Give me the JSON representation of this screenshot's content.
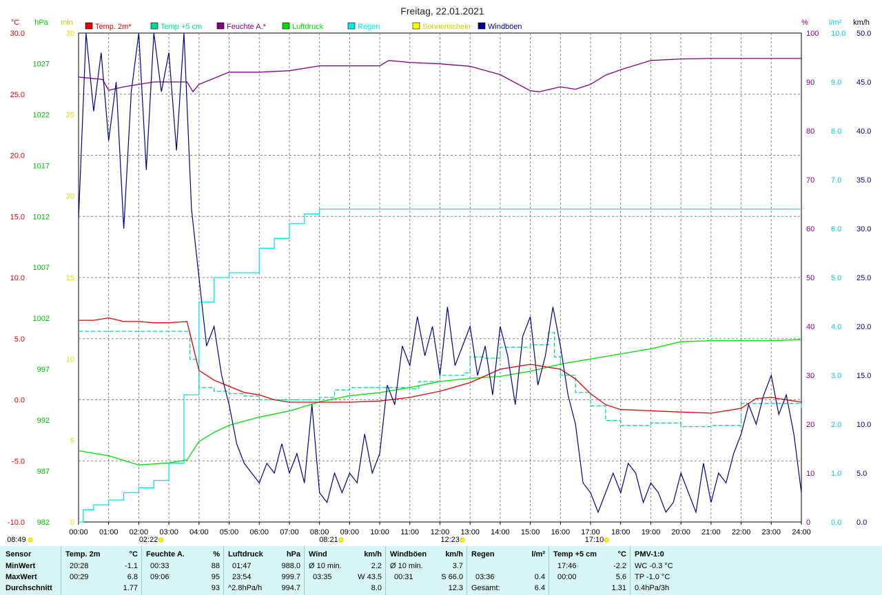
{
  "title": "Freitag, 22.01.2021",
  "colors": {
    "temp2m": "#e00000",
    "temp5cm": "#00d890",
    "humidity": "#800080",
    "pressure": "#00dd00",
    "rain": "#00e8e8",
    "sunshine": "#ffff00",
    "gusts": "#00008b",
    "grid": "#808080"
  },
  "axis_units": {
    "temp": "°C",
    "pressure": "hPa",
    "sunshine": "min",
    "humidity": "%",
    "rain": "l/m²",
    "wind": "km/h"
  },
  "chart_data": {
    "type": "line",
    "legend": [
      {
        "name": "Temp. 2m*",
        "color": "#e00000"
      },
      {
        "name": "Temp +5 cm",
        "color": "#00d890"
      },
      {
        "name": "Feuchte A.*",
        "color": "#800080"
      },
      {
        "name": "Luftdruck",
        "color": "#00dd00"
      },
      {
        "name": "Regen",
        "color": "#00e8e8"
      },
      {
        "name": "Sonnenschein",
        "color": "#ffff00"
      },
      {
        "name": "Windböen",
        "color": "#00008b"
      }
    ],
    "x_ticks": [
      "00:00",
      "01:00",
      "02:00",
      "03:00",
      "04:00",
      "05:00",
      "06:00",
      "07:00",
      "08:00",
      "09:00",
      "10:00",
      "11:00",
      "12:00",
      "13:00",
      "14:00",
      "15:00",
      "16:00",
      "17:00",
      "18:00",
      "19:00",
      "20:00",
      "21:00",
      "22:00",
      "23:00",
      "24:00"
    ],
    "xlim": [
      0,
      24
    ],
    "temp_axis": {
      "ylim": [
        -10,
        30
      ],
      "ticks": [
        "-10.0",
        "-5.0",
        "0.0",
        "5.0",
        "10.0",
        "15.0",
        "20.0",
        "25.0",
        "30.0"
      ]
    },
    "pressure_axis": {
      "ylim": [
        982,
        1030
      ],
      "ticks": [
        "982",
        "987",
        "992",
        "997",
        "1002",
        "1007",
        "1012",
        "1017",
        "1022",
        "1027"
      ]
    },
    "sunshine_axis": {
      "ylim": [
        0,
        30
      ],
      "ticks": [
        "0",
        "5",
        "10",
        "15",
        "20",
        "25",
        "30"
      ]
    },
    "humidity_axis": {
      "ylim": [
        0,
        100
      ],
      "ticks": [
        "0",
        "10",
        "20",
        "30",
        "40",
        "50",
        "60",
        "70",
        "80",
        "90",
        "100"
      ]
    },
    "rain_axis": {
      "ylim": [
        0,
        10
      ],
      "ticks": [
        "0.0",
        "1.0",
        "2.0",
        "3.0",
        "4.0",
        "5.0",
        "6.0",
        "7.0",
        "8.0",
        "9.0",
        "10.0"
      ]
    },
    "wind_axis": {
      "ylim": [
        0,
        50
      ],
      "ticks": [
        "0.0",
        "5.0",
        "10.0",
        "15.0",
        "20.0",
        "25.0",
        "30.0",
        "35.0",
        "40.0",
        "45.0",
        "50.0"
      ]
    },
    "sun_markers": [
      {
        "label": "08:49",
        "hour": 0.0
      },
      {
        "label": "02:22",
        "hour": 2.37
      },
      {
        "label": "08:21",
        "hour": 8.35
      },
      {
        "label": "12:23",
        "hour": 12.38
      },
      {
        "label": "17:10",
        "hour": 17.17
      }
    ],
    "series": [
      {
        "name": "Temp. 2m*",
        "axis": "temp",
        "x": [
          0,
          0.5,
          1,
          1.5,
          2,
          2.5,
          3,
          3.6,
          4,
          4.5,
          5,
          5.5,
          6,
          6.5,
          7,
          8,
          9,
          10,
          11,
          12,
          13,
          14,
          15,
          16,
          16.5,
          17,
          17.5,
          18,
          19,
          20,
          21,
          21.5,
          22,
          22.5,
          23,
          23.5,
          24
        ],
        "y": [
          6.5,
          6.5,
          6.7,
          6.4,
          6.4,
          6.3,
          6.3,
          6.4,
          2.4,
          1.6,
          1.1,
          0.6,
          0.4,
          0.0,
          -0.2,
          -0.2,
          -0.2,
          -0.1,
          0.2,
          0.7,
          1.4,
          2.5,
          2.9,
          2.5,
          1.7,
          0.5,
          -0.4,
          -0.8,
          -0.9,
          -1.0,
          -1.1,
          -0.9,
          -0.7,
          0.1,
          0.2,
          0.0,
          -0.2
        ]
      },
      {
        "name": "Temp +5 cm",
        "axis": "temp",
        "x": [
          0,
          1,
          1.8,
          2.2,
          3,
          3.6,
          3.7,
          4,
          4.5,
          5,
          5.5,
          6,
          7,
          8,
          8.5,
          9,
          10,
          11,
          11.3,
          12,
          12.8,
          13,
          13.5,
          14,
          15,
          15.6,
          15.8,
          16,
          16.5,
          17,
          17.5,
          18,
          19,
          20,
          21,
          22,
          23,
          24
        ],
        "y": [
          5.6,
          5.6,
          5.6,
          5.6,
          5.6,
          5.6,
          3.3,
          1.0,
          0.7,
          0.5,
          0.3,
          0.0,
          0.0,
          0.2,
          0.8,
          1.0,
          1.0,
          0.9,
          1.5,
          2.0,
          2.2,
          3.5,
          3.4,
          4.3,
          4.5,
          5.5,
          3.5,
          2.0,
          0.6,
          -0.5,
          -1.7,
          -2.1,
          -1.9,
          -2.2,
          -2.1,
          -0.3,
          -0.3,
          -0.8
        ]
      },
      {
        "name": "Feuchte A.*",
        "axis": "humidity",
        "x": [
          0,
          0.8,
          1,
          1.5,
          2,
          2.5,
          3,
          3.6,
          3.8,
          4,
          5,
          6,
          7,
          8,
          9,
          10,
          10.3,
          11,
          12,
          13,
          14,
          15,
          15.3,
          16,
          16.5,
          17,
          17.5,
          18,
          19,
          20,
          21,
          22,
          23,
          24
        ],
        "y": [
          91,
          90.5,
          88.3,
          89,
          89.5,
          90,
          90,
          90,
          88,
          89.5,
          92,
          92,
          92.3,
          93.3,
          93.3,
          93.3,
          94.4,
          94,
          93.7,
          93.2,
          91.5,
          88.2,
          88,
          89,
          88.5,
          89.5,
          91.4,
          92.5,
          94.4,
          94.7,
          94.8,
          94.8,
          94.8,
          94.8
        ]
      },
      {
        "name": "Luftdruck",
        "axis": "pressure",
        "x": [
          0,
          1,
          2,
          3,
          3.6,
          4,
          4.5,
          5,
          6,
          7,
          8,
          9,
          10,
          11,
          12,
          13,
          14,
          15,
          16,
          17,
          18,
          19,
          20,
          21,
          22,
          23,
          24
        ],
        "y": [
          989,
          988.5,
          987.6,
          987.8,
          988.1,
          989.9,
          990.8,
          991.5,
          992.3,
          992.9,
          993.8,
          994.4,
          994.7,
          995.2,
          995.8,
          996.1,
          996.3,
          996.8,
          997.5,
          998,
          998.5,
          999,
          999.7,
          999.8,
          999.8,
          999.8,
          999.9
        ]
      },
      {
        "name": "Regen",
        "axis": "rain",
        "x": [
          0,
          0.15,
          0.5,
          1,
          1.5,
          2,
          2.5,
          3,
          3.5,
          4,
          4.5,
          5,
          6,
          6.5,
          7,
          7.5,
          8,
          9,
          10,
          11,
          12,
          24
        ],
        "y": [
          0,
          0.25,
          0.35,
          0.45,
          0.6,
          0.7,
          0.85,
          1.2,
          2.6,
          4.5,
          5.0,
          5.1,
          5.6,
          5.8,
          6.1,
          6.3,
          6.4,
          6.4,
          6.4,
          6.4,
          6.4,
          6.4
        ]
      },
      {
        "name": "Windböen",
        "axis": "wind",
        "x": [
          0,
          0.25,
          0.5,
          0.75,
          1,
          1.25,
          1.5,
          1.75,
          2,
          2.25,
          2.5,
          2.75,
          3,
          3.25,
          3.5,
          3.75,
          4,
          4.25,
          4.5,
          4.75,
          5,
          5.25,
          5.5,
          5.75,
          6,
          6.25,
          6.5,
          6.75,
          7,
          7.25,
          7.5,
          7.75,
          8,
          8.25,
          8.5,
          8.75,
          9,
          9.25,
          9.5,
          9.75,
          10,
          10.25,
          10.5,
          10.75,
          11,
          11.25,
          11.5,
          11.75,
          12,
          12.25,
          12.5,
          12.75,
          13,
          13.25,
          13.5,
          13.75,
          14,
          14.25,
          14.5,
          14.75,
          15,
          15.25,
          15.5,
          15.75,
          16,
          16.25,
          16.5,
          16.75,
          17,
          17.25,
          17.5,
          17.75,
          18,
          18.25,
          18.5,
          18.75,
          19,
          19.25,
          19.5,
          19.75,
          20,
          20.25,
          20.5,
          20.75,
          21,
          21.25,
          21.5,
          21.75,
          22,
          22.25,
          22.5,
          22.75,
          23,
          23.25,
          23.5,
          23.75,
          24
        ],
        "y": [
          31,
          50,
          42,
          48,
          39,
          45,
          30,
          44,
          50,
          36,
          50,
          44,
          48,
          38,
          50,
          32,
          25,
          18,
          20,
          15,
          12,
          8,
          6,
          5,
          4,
          6,
          5,
          8,
          5,
          7,
          4,
          12,
          3,
          2,
          5,
          3,
          5,
          4,
          9,
          5,
          7,
          14,
          12,
          18,
          16,
          21,
          17,
          20,
          15,
          22,
          16,
          18,
          20,
          15,
          18,
          13,
          20,
          17,
          12,
          19,
          21,
          14,
          17,
          22,
          18,
          13,
          10,
          4,
          3,
          1,
          3,
          5,
          3,
          6,
          5,
          2,
          4,
          3,
          1,
          2,
          5,
          3,
          1,
          6,
          2,
          5,
          4,
          7,
          9,
          12,
          10,
          13,
          15,
          11,
          13,
          9,
          3
        ]
      }
    ]
  },
  "stats": {
    "sensor": {
      "header": "Sensor",
      "rows": [
        "MinWert",
        "MaxWert",
        "Durchschnitt"
      ]
    },
    "temp2m": {
      "header": "Temp. 2m",
      "unit": "°C",
      "min_time": "20:28",
      "min_val": "-1.1",
      "max_time": "00:29",
      "max_val": "6.8",
      "avg": "1.77"
    },
    "humidity": {
      "header": "Feuchte A.",
      "unit": "%",
      "min_time": "00:33",
      "min_val": "88",
      "max_time": "09:06",
      "max_val": "95",
      "avg": "93"
    },
    "pressure": {
      "header": "Luftdruck",
      "unit": "hPa",
      "min_time": "01:47",
      "min_val": "988.0",
      "max_time": "23:54",
      "max_val": "999.7",
      "trend": "^2.8hPa/h",
      "avg": "994.7"
    },
    "wind": {
      "header": "Wind",
      "unit": "km/h",
      "row1_label": "Ø 10 min.",
      "row1_val": "2.2",
      "max_time": "03:35",
      "max_val": "W 43.5",
      "avg": "8.0"
    },
    "gusts": {
      "header": "Windböen",
      "unit": "km/h",
      "row1_label": "Ø 10 min.",
      "row1_val": "3.7",
      "max_time": "00:31",
      "max_val": "S 66.0",
      "avg": "12.3"
    },
    "rain": {
      "header": "Regen",
      "unit": "l/m²",
      "max_time": "03:36",
      "max_val": "0.4",
      "total_label": "Gesamt:",
      "total": "6.4"
    },
    "temp5cm": {
      "header": "Temp +5 cm",
      "unit": "°C",
      "min_time": "17:46",
      "min_val": "-2.2",
      "max_time": "00:00",
      "max_val": "5.6",
      "avg": "1.31"
    },
    "pmv": {
      "header": "PMV-1:0",
      "wc": "WC -0.3 °C",
      "tp": "TP -1.0 °C",
      "trend": "0.4hPa/3h"
    }
  }
}
